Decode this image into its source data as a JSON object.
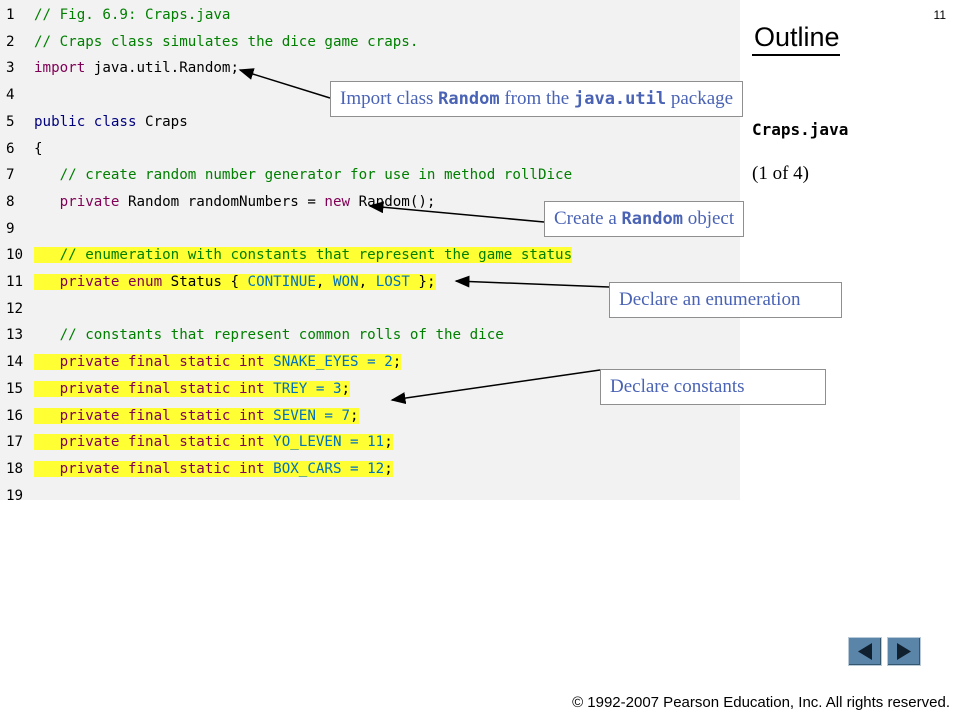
{
  "page": {
    "number": "11",
    "outline": "Outline",
    "file": "Craps.java",
    "page_of": "(1 of 4)"
  },
  "code_lines": [
    {
      "n": "1",
      "hl": false,
      "parts": [
        {
          "t": "// Fig. 6.9: Craps.java",
          "c": "c"
        }
      ]
    },
    {
      "n": "2",
      "hl": false,
      "parts": [
        {
          "t": "// Craps class simulates the dice game craps.",
          "c": "c"
        }
      ]
    },
    {
      "n": "3",
      "hl": false,
      "parts": [
        {
          "t": "import",
          "c": "k"
        },
        {
          "t": " java.util.Random;",
          "c": "t"
        }
      ]
    },
    {
      "n": "4",
      "hl": false,
      "parts": []
    },
    {
      "n": "5",
      "hl": false,
      "parts": [
        {
          "t": "public class",
          "c": "k2"
        },
        {
          "t": " Craps",
          "c": "t"
        }
      ]
    },
    {
      "n": "6",
      "hl": false,
      "parts": [
        {
          "t": "{",
          "c": "t"
        }
      ]
    },
    {
      "n": "7",
      "hl": false,
      "parts": [
        {
          "t": "   // create random number generator for use in method rollDice",
          "c": "c"
        }
      ]
    },
    {
      "n": "8",
      "hl": false,
      "parts": [
        {
          "t": "   ",
          "c": "t"
        },
        {
          "t": "private",
          "c": "k"
        },
        {
          "t": " Random randomNumbers = ",
          "c": "t"
        },
        {
          "t": "new",
          "c": "k"
        },
        {
          "t": " Random();",
          "c": "t"
        }
      ]
    },
    {
      "n": "9",
      "hl": false,
      "parts": []
    },
    {
      "n": "10",
      "hl": true,
      "parts": [
        {
          "t": "   // enumeration with constants that represent the game status",
          "c": "c"
        }
      ]
    },
    {
      "n": "11",
      "hl": true,
      "parts": [
        {
          "t": "   ",
          "c": "t"
        },
        {
          "t": "private enum",
          "c": "k"
        },
        {
          "t": " Status { ",
          "c": "t"
        },
        {
          "t": "CONTINUE",
          "c": "cst"
        },
        {
          "t": ", ",
          "c": "t"
        },
        {
          "t": "WON",
          "c": "cst"
        },
        {
          "t": ", ",
          "c": "t"
        },
        {
          "t": "LOST",
          "c": "cst"
        },
        {
          "t": " };",
          "c": "t"
        }
      ]
    },
    {
      "n": "12",
      "hl": false,
      "parts": []
    },
    {
      "n": "13",
      "hl": false,
      "parts": [
        {
          "t": "   // constants that represent common rolls of the dice",
          "c": "c"
        }
      ]
    },
    {
      "n": "14",
      "hl": true,
      "parts": [
        {
          "t": "   ",
          "c": "t"
        },
        {
          "t": "private final static int",
          "c": "k"
        },
        {
          "t": " ",
          "c": "t"
        },
        {
          "t": "SNAKE_EYES = 2",
          "c": "cst"
        },
        {
          "t": ";",
          "c": "t"
        }
      ]
    },
    {
      "n": "15",
      "hl": true,
      "parts": [
        {
          "t": "   ",
          "c": "t"
        },
        {
          "t": "private final static int",
          "c": "k"
        },
        {
          "t": " ",
          "c": "t"
        },
        {
          "t": "TREY = 3",
          "c": "cst"
        },
        {
          "t": ";",
          "c": "t"
        }
      ]
    },
    {
      "n": "16",
      "hl": true,
      "parts": [
        {
          "t": "   ",
          "c": "t"
        },
        {
          "t": "private final static int",
          "c": "k"
        },
        {
          "t": " ",
          "c": "t"
        },
        {
          "t": "SEVEN = 7",
          "c": "cst"
        },
        {
          "t": ";",
          "c": "t"
        }
      ]
    },
    {
      "n": "17",
      "hl": true,
      "parts": [
        {
          "t": "   ",
          "c": "t"
        },
        {
          "t": "private final static int",
          "c": "k"
        },
        {
          "t": " ",
          "c": "t"
        },
        {
          "t": "YO_LEVEN = 11",
          "c": "cst"
        },
        {
          "t": ";",
          "c": "t"
        }
      ]
    },
    {
      "n": "18",
      "hl": true,
      "parts": [
        {
          "t": "   ",
          "c": "t"
        },
        {
          "t": "private final static int",
          "c": "k"
        },
        {
          "t": " ",
          "c": "t"
        },
        {
          "t": "BOX_CARS = 12",
          "c": "cst"
        },
        {
          "t": ";",
          "c": "t"
        }
      ]
    },
    {
      "n": "19",
      "hl": false,
      "parts": []
    }
  ],
  "callouts": {
    "import": {
      "a": "Import class ",
      "b": "Random",
      "c": " from the ",
      "d": "java.util",
      "e": " package"
    },
    "random": {
      "a": "Create a ",
      "b": "Random",
      "c": " object"
    },
    "enum": "Declare an enumeration",
    "constants": "Declare constants"
  },
  "nav": {
    "prev": "previous-slide",
    "next": "next-slide"
  },
  "copyright": "© 1992-2007 Pearson Education, Inc.  All rights reserved.",
  "colors": {
    "highlight": "#ffff33",
    "comment": "#007f00",
    "keyword": "#7f0055",
    "constant": "#0070c0",
    "callout_text": "#4a63b5"
  }
}
